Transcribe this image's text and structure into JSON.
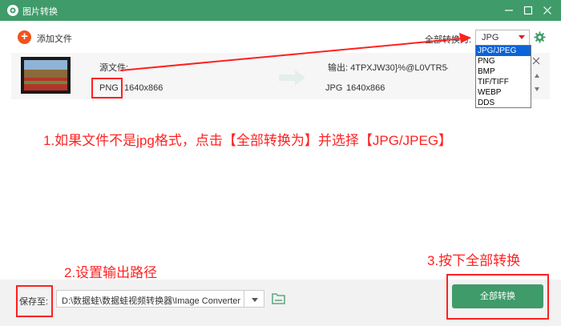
{
  "window": {
    "title": "图片转换",
    "app_icon": "camera-app-icon",
    "controls": [
      "minimize-icon",
      "maximize-icon",
      "close-icon"
    ]
  },
  "toolbar": {
    "add_label": "添加文件",
    "convert_all_label": "全部转换为:",
    "format_selected": "JPG",
    "settings_icon": "gear-icon"
  },
  "file": {
    "src_label": "源文件:",
    "src_format": "PNG",
    "src_dims": "1640x866",
    "out_label": "输出: 4TPXJW30}%@L0VTR5{NBWPU",
    "out_format": "JPG",
    "out_dims": "1640x866"
  },
  "dropdown": {
    "items": [
      "JPG/JPEG",
      "PNG",
      "BMP",
      "TIF/TIFF",
      "WEBP",
      "DDS"
    ],
    "selected_index": 0
  },
  "bottom": {
    "save_label": "保存至:",
    "path": "D:\\数据蛙\\数据蛙视频转换器\\Image Converter",
    "convert_btn": "全部转换"
  },
  "annotations": {
    "step1": "1.如果文件不是jpg格式，点击【全部转换为】并选择【JPG/JPEG】",
    "step2": "2.设置输出路径",
    "step3": "3.按下全部转换"
  },
  "colors": {
    "brand_green": "#3f9b6a",
    "add_orange": "#f0531c",
    "annotation_red": "#ff2222",
    "select_blue": "#0a64d8"
  }
}
